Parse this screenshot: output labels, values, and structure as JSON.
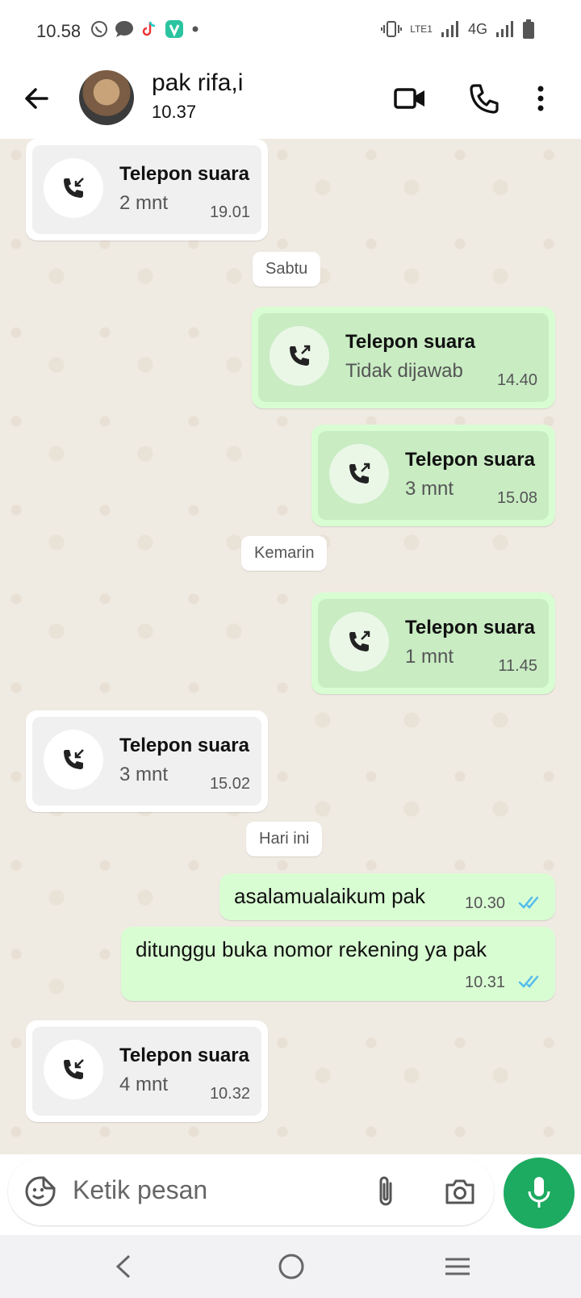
{
  "status_bar": {
    "time": "10.58",
    "network": "4G",
    "volte": "LTE1"
  },
  "header": {
    "contact_name": "pak rifa,i",
    "subtitle": "10.37"
  },
  "colors": {
    "accent": "#1daa61",
    "outgoing_bubble": "#d9fdd3",
    "chat_bg": "#efeae2",
    "read_ticks": "#53bdeb"
  },
  "messages": {
    "call1": {
      "title": "Telepon suara",
      "sub": "2 mnt",
      "time": "19.01"
    },
    "day1": "Sabtu",
    "call2": {
      "title": "Telepon suara",
      "sub": "Tidak dijawab",
      "time": "14.40"
    },
    "call3": {
      "title": "Telepon suara",
      "sub": "3 mnt",
      "time": "15.08"
    },
    "day2": "Kemarin",
    "call4": {
      "title": "Telepon suara",
      "sub": "1 mnt",
      "time": "11.45"
    },
    "call5": {
      "title": "Telepon suara",
      "sub": "3 mnt",
      "time": "15.02"
    },
    "day3": "Hari ini",
    "text1": {
      "text": "asalamualaikum pak",
      "time": "10.30"
    },
    "text2": {
      "text": "ditunggu buka nomor rekening ya pak",
      "time": "10.31"
    },
    "call6": {
      "title": "Telepon suara",
      "sub": "4 mnt",
      "time": "10.32"
    }
  },
  "input": {
    "placeholder": "Ketik pesan"
  }
}
